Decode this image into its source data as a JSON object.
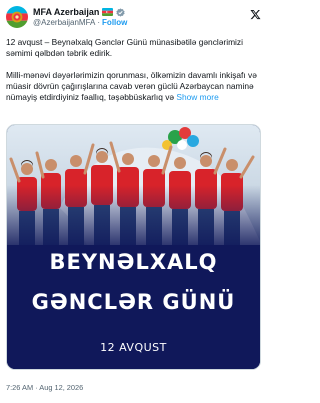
{
  "account": {
    "name": "MFA Azerbaijan",
    "handle": "@AzerbaijanMFA",
    "separator": "·",
    "follow_label": "Follow",
    "avatar_icon": "azerbaijan-emblem-icon",
    "flag_icon": "azerbaijan-flag-icon",
    "verified_icon": "gray-verified-badge-icon",
    "platform_icon": "x-logo-icon"
  },
  "tweet": {
    "paragraph1": "12 avqust – Beynəlxalq Gənclər Günü münasibətilə gənclərimizi səmimi qəlbdən təbrik edirik.",
    "paragraph2": "Milli-mənəvi dəyərlərimizin qorunması, ölkəmizin davamlı inkişafı və müasir dövrün çağırışlarına cavab verən güclü Azərbaycan naminə nümayiş etdirdiyiniz fəallıq, təşəbbüskarlıq və",
    "show_more_label": "Show more"
  },
  "media": {
    "headline_line1": "BEYNƏLXALQ",
    "headline_line2": "GƏNCLƏR GÜNÜ",
    "date_line": "12 AVQUST"
  },
  "meta": {
    "timestamp": "7:26 AM · Aug 12, 2026"
  },
  "colors": {
    "link": "#1d9bf0",
    "secondary_text": "#536471",
    "media_background": "#10185a",
    "shirt_red": "#d8232a"
  }
}
